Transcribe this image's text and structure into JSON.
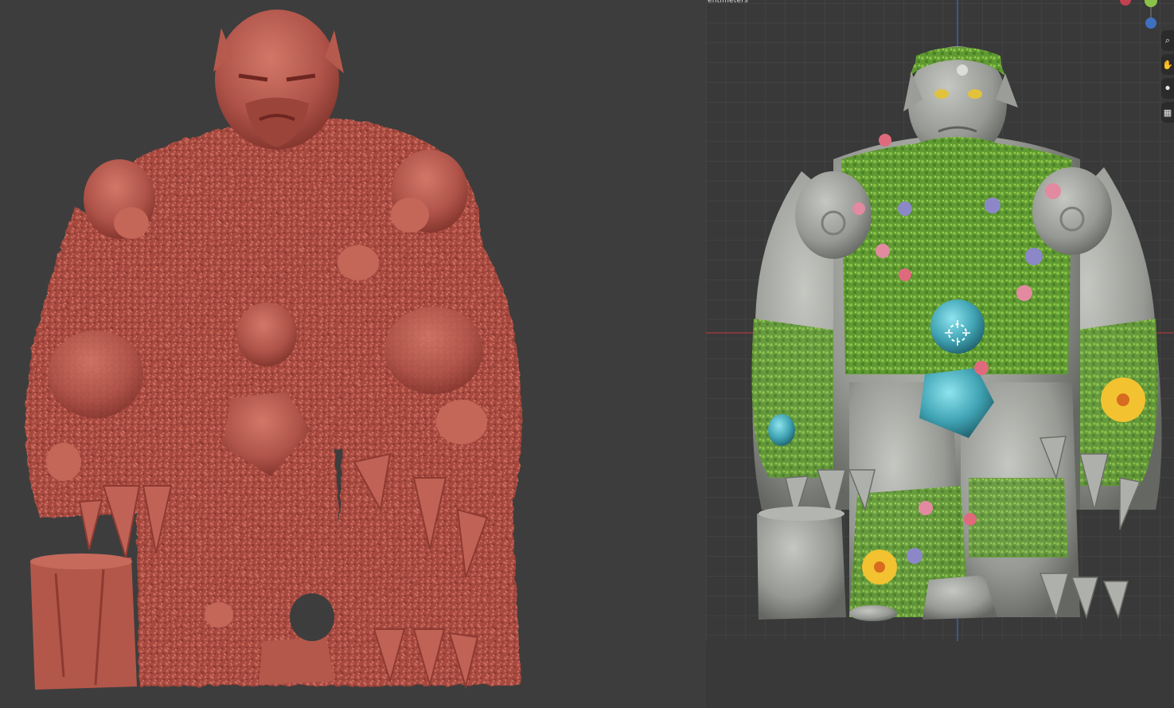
{
  "left_viewport": {
    "name": "sculpt-preview",
    "colors": {
      "background": "#3d3d3d",
      "clay": "#b25549",
      "clay_dark": "#7e3029",
      "clay_light": "#cf7465"
    }
  },
  "right_viewport": {
    "name": "textured-preview",
    "units_label": "entimeters",
    "colors": {
      "background": "#393939",
      "grid": "#4b4b4b",
      "x_axis": "#b0393f",
      "z_axis": "#3c6bb0",
      "stone": "#9ea09a",
      "moss": "#6ea53a",
      "gem": "#3fa2b2",
      "flower_yellow": "#f2c230",
      "flower_pink": "#e28aa0"
    },
    "gizmo": {
      "axes": [
        "x-red",
        "y-green",
        "z-blue"
      ]
    },
    "nav_tools": [
      {
        "icon": "magnifier-icon",
        "glyph": "⌕"
      },
      {
        "icon": "hand-pan-icon",
        "glyph": "✋"
      },
      {
        "icon": "camera-icon",
        "glyph": "⏺"
      },
      {
        "icon": "grid-icon",
        "glyph": "▦"
      }
    ]
  }
}
